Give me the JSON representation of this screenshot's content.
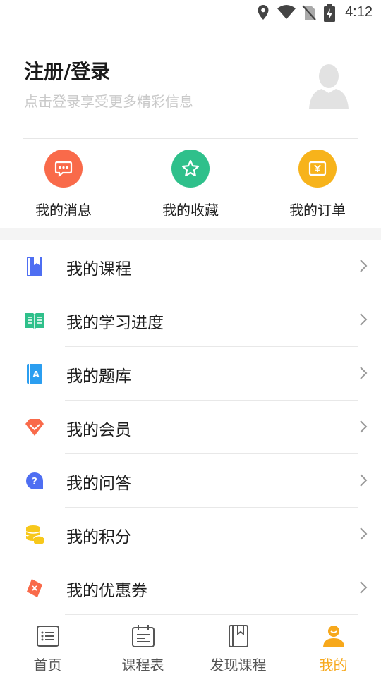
{
  "status_bar": {
    "time": "4:12",
    "icons": [
      "location-icon",
      "wifi-icon",
      "no-sim-icon",
      "battery-charging-icon"
    ]
  },
  "profile": {
    "title": "注册/登录",
    "subtitle": "点击登录享受更多精彩信息",
    "avatar_icon": "avatar-placeholder-icon"
  },
  "quick_actions": [
    {
      "label": "我的消息",
      "icon": "message-icon",
      "color": "#f96a4a"
    },
    {
      "label": "我的收藏",
      "icon": "star-icon",
      "color": "#2fc08b"
    },
    {
      "label": "我的订单",
      "icon": "order-yen-icon",
      "color": "#f7b31b"
    }
  ],
  "menu": [
    {
      "label": "我的课程",
      "icon": "course-book-icon",
      "color": "#4e6ef2"
    },
    {
      "label": "我的学习进度",
      "icon": "open-book-icon",
      "color": "#2fc08b"
    },
    {
      "label": "我的题库",
      "icon": "question-bank-icon",
      "color": "#2b9ef0"
    },
    {
      "label": "我的会员",
      "icon": "diamond-icon",
      "color": "#f96a4a"
    },
    {
      "label": "我的问答",
      "icon": "question-bubble-icon",
      "color": "#4e6ef2"
    },
    {
      "label": "我的积分",
      "icon": "coins-icon",
      "color": "#f7c81b"
    },
    {
      "label": "我的优惠券",
      "icon": "coupon-icon",
      "color": "#f96a4a"
    }
  ],
  "bottom_nav": [
    {
      "label": "首页",
      "icon": "home-list-icon",
      "active": false
    },
    {
      "label": "课程表",
      "icon": "calendar-icon",
      "active": false
    },
    {
      "label": "发现课程",
      "icon": "discover-book-icon",
      "active": false
    },
    {
      "label": "我的",
      "icon": "profile-icon",
      "active": true,
      "active_color": "#f7a81b"
    }
  ]
}
